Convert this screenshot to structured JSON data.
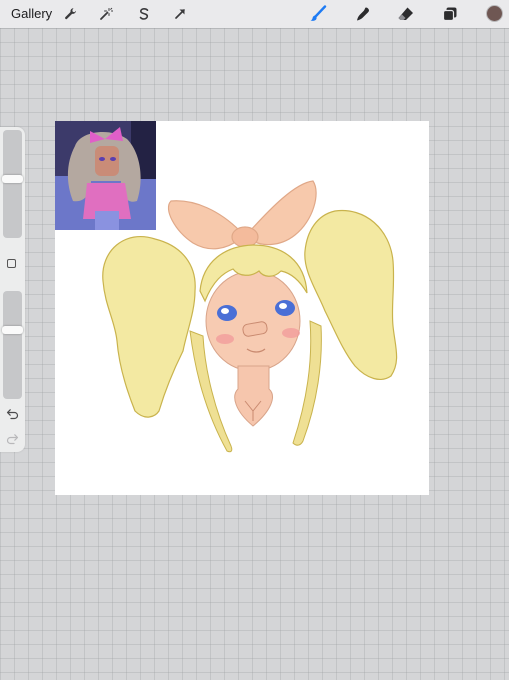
{
  "toolbar": {
    "gallery_label": "Gallery",
    "left_tools": [
      "wrench-icon",
      "magic-wand-icon",
      "selection-icon",
      "transform-arrow-icon"
    ],
    "right_tools": [
      "brush-icon",
      "smudge-icon",
      "eraser-icon",
      "layers-icon"
    ],
    "active_tool": "brush",
    "accent_color": "#1e7bf4",
    "current_color": "#6f5753"
  },
  "sidebar": {
    "brush_size_level": 0.55,
    "opacity_level": 0.65,
    "modify_icon": "square-icon",
    "undo_icon": "undo-arrow-icon",
    "redo_icon": "redo-arrow-icon"
  },
  "canvas": {
    "background": "#ffffff",
    "content": "digital-drawing",
    "reference_image": "reference-photo"
  },
  "colors": {
    "hair": "#f3e9a2",
    "hair_outline": "#c9b34d",
    "skin": "#f7cbb2",
    "bow": "#f7c9ac",
    "eye": "#4a6fd6",
    "blush": "#f29999"
  }
}
